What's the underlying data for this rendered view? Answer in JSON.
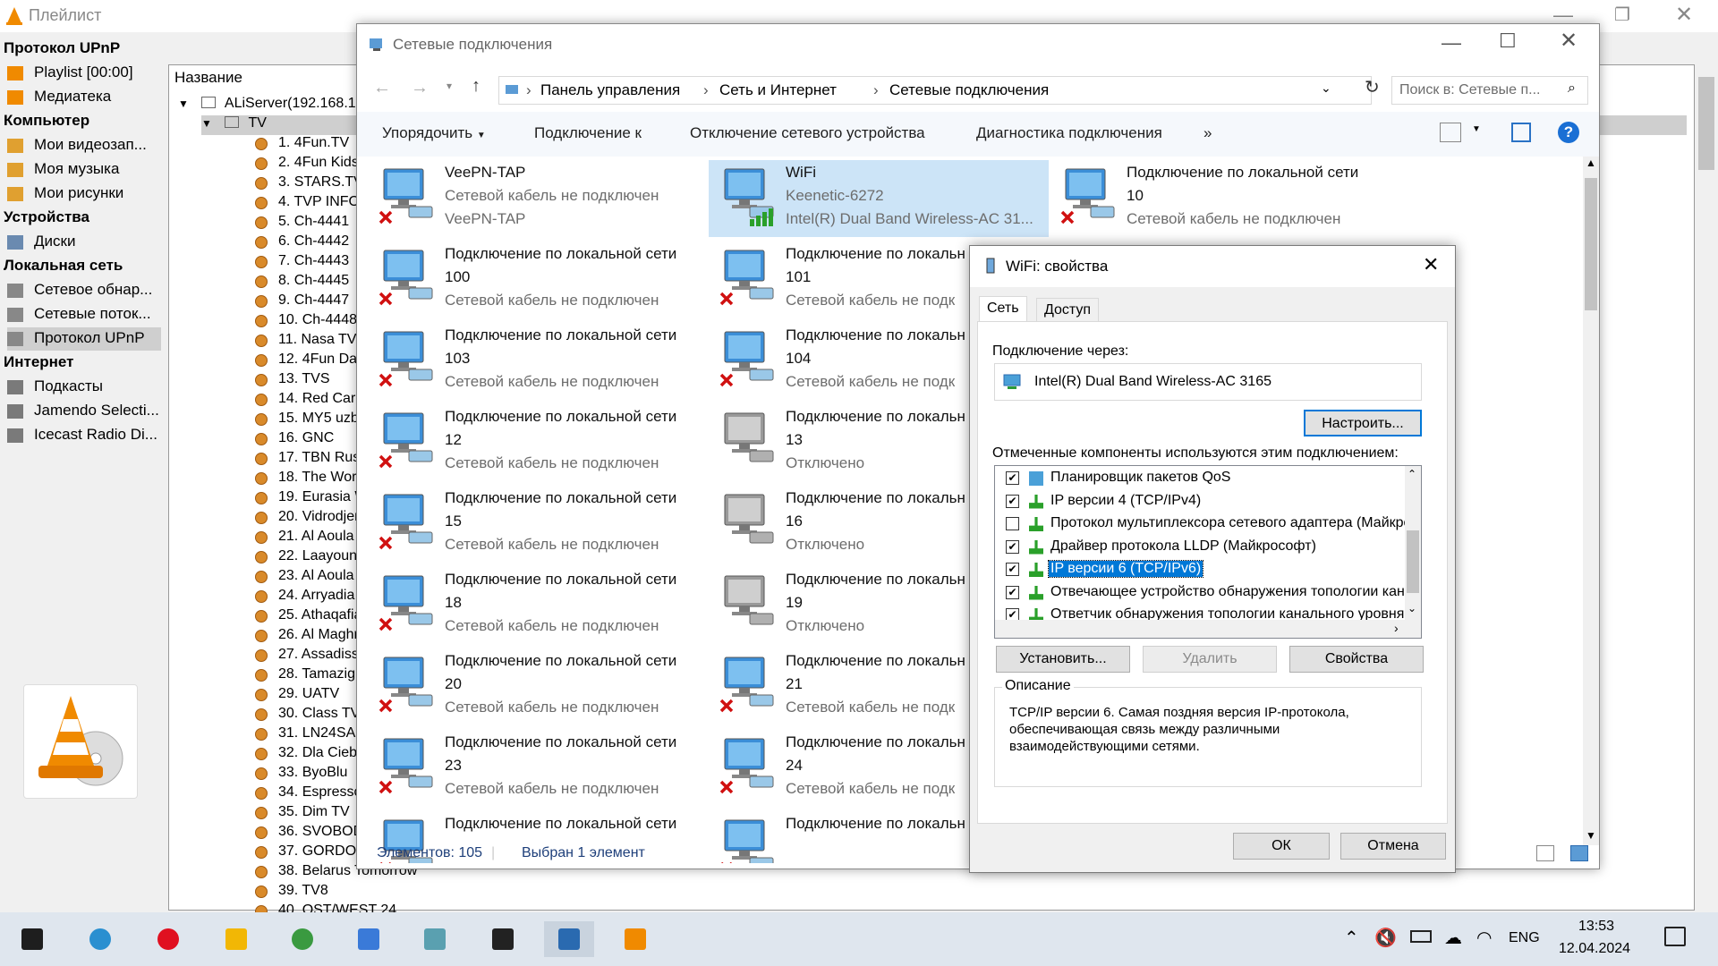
{
  "vlc": {
    "title": "Плейлист",
    "sidebar": {
      "sections": [
        {
          "header": "Протокол UPnP",
          "items": [
            "Playlist [00:00]",
            "Медиатека"
          ]
        },
        {
          "header": "Компьютер",
          "items": [
            "Мои видеозап...",
            "Моя музыка",
            "Мои рисунки"
          ]
        },
        {
          "header": "Устройства",
          "items": [
            "Диски"
          ]
        },
        {
          "header": "Локальная сеть",
          "items": [
            "Сетевое обнар...",
            "Сетевые поток...",
            "Протокол UPnP"
          ]
        },
        {
          "header": "Интернет",
          "items": [
            "Подкасты",
            "Jamendo Selecti...",
            "Icecast Radio Di..."
          ]
        }
      ]
    },
    "tree": {
      "header": "Название",
      "server": "ALiServer(192.168.1.",
      "folder": "TV",
      "channels": [
        "1. 4Fun.TV",
        "2. 4Fun Kids",
        "3. STARS.TV",
        "4. TVP INFO",
        "5. Ch-4441",
        "6. Ch-4442",
        "7. Ch-4443",
        "8. Ch-4445",
        "9. Ch-4447",
        "10. Ch-4448",
        "11. Nasa TV",
        "12. 4Fun Dar",
        "13. TVS",
        "14. Red Carp",
        "15. MY5 uzb",
        "16. GNC",
        "17. TBN Rus",
        "18. The Wor",
        "19. Eurasia W",
        "20. Vidrodjer",
        "21. Al Aoula",
        "22. Laayoune",
        "23. Al Aoula",
        "24. Arryadia",
        "25. Athaqafia",
        "26. Al Maghr",
        "27. Assadiss",
        "28. Tamazigh",
        "29. UATV",
        "30. Class TV",
        "31. LN24SA",
        "32. Dla Ciebi",
        "33. ByoBlu",
        "34. Espresso",
        "35. Dim TV",
        "36. SVOBOD",
        "37. GORDON",
        "38. Belarus Tomorrow",
        "39. TV8",
        "40. OST/WEST 24"
      ]
    }
  },
  "explorer": {
    "title": "Сетевые подключения",
    "breadcrumb": [
      "Панель управления",
      "Сеть и Интернет",
      "Сетевые подключения"
    ],
    "search_placeholder": "Поиск в: Сетевые п...",
    "commands": [
      "Упорядочить",
      "Подключение к",
      "Отключение сетевого устройства",
      "Диагностика подключения",
      "»"
    ],
    "connections": [
      {
        "name": "VeePN-TAP",
        "status": "Сетевой кабель не подключен",
        "device": "VeePN-TAP",
        "state": "disconnected"
      },
      {
        "name": "WiFi",
        "status": "Keenetic-6272",
        "device": "Intel(R) Dual Band Wireless-AC 31...",
        "state": "wifi"
      },
      {
        "name": "Подключение по локальной сети",
        "name2": "10",
        "status": "Сетевой кабель не подключен",
        "state": "disconnected"
      },
      {
        "name": "Подключение по локальной сети",
        "name2": "100",
        "status": "Сетевой кабель не подключен",
        "state": "disconnected"
      },
      {
        "name": "Подключение по локальн",
        "name2": "101",
        "status": "Сетевой кабель не подк",
        "state": "disconnected"
      },
      {
        "name": "Подключение по локальной сети",
        "name2": "103",
        "status": "Сетевой кабель не подключен",
        "state": "disconnected"
      },
      {
        "name": "Подключение по локальн",
        "name2": "104",
        "status": "Сетевой кабель не подк",
        "state": "disconnected"
      },
      {
        "name": "Подключение по локальной сети",
        "name2": "12",
        "status": "Сетевой кабель не подключен",
        "state": "disconnected"
      },
      {
        "name": "Подключение по локальн",
        "name2": "13",
        "status": "Отключено",
        "state": "disabled"
      },
      {
        "name": "Подключение по локальной сети",
        "name2": "15",
        "status": "Сетевой кабель не подключен",
        "state": "disconnected"
      },
      {
        "name": "Подключение по локальн",
        "name2": "16",
        "status": "Отключено",
        "state": "disabled"
      },
      {
        "name": "Подключение по локальной сети",
        "name2": "18",
        "status": "Сетевой кабель не подключен",
        "state": "disconnected"
      },
      {
        "name": "Подключение по локальн",
        "name2": "19",
        "status": "Отключено",
        "state": "disabled"
      },
      {
        "name": "Подключение по локальной сети",
        "name2": "20",
        "status": "Сетевой кабель не подключен",
        "state": "disconnected"
      },
      {
        "name": "Подключение по локальн",
        "name2": "21",
        "status": "Сетевой кабель не подк",
        "state": "disconnected"
      },
      {
        "name": "Подключение по локальной сети",
        "name2": "23",
        "status": "Сетевой кабель не подключен",
        "state": "disconnected"
      },
      {
        "name": "Подключение по локальн",
        "name2": "24",
        "status": "Сетевой кабель не подк",
        "state": "disconnected"
      },
      {
        "name": "Подключение по локальной сети",
        "name2": "",
        "status": "",
        "state": "disconnected"
      },
      {
        "name": "Подключение по локальн",
        "name2": "",
        "status": "",
        "state": "disconnected"
      }
    ],
    "status_count": "Элементов: 105",
    "status_selected": "Выбран 1 элемент"
  },
  "dialog": {
    "title": "WiFi: свойства",
    "tabs": [
      "Сеть",
      "Доступ"
    ],
    "connect_using_label": "Подключение через:",
    "adapter": "Intel(R) Dual Band Wireless-AC 3165",
    "configure": "Настроить...",
    "components_label": "Отмеченные компоненты используются этим подключением:",
    "components": [
      {
        "label": "Планировщик пакетов QoS",
        "checked": true
      },
      {
        "label": "IP версии 4 (TCP/IPv4)",
        "checked": true
      },
      {
        "label": "Протокол мультиплексора сетевого адаптера (Майкрософт)",
        "checked": false
      },
      {
        "label": "Драйвер протокола LLDP (Майкрософт)",
        "checked": true
      },
      {
        "label": "IP версии 6 (TCP/IPv6)",
        "checked": true,
        "selected": true
      },
      {
        "label": "Отвечающее устройство обнаружения топологии канального уровня",
        "checked": true
      },
      {
        "label": "Ответчик обнаружения топологии канального уровня",
        "checked": true
      }
    ],
    "install": "Установить...",
    "uninstall": "Удалить",
    "properties": "Свойства",
    "description_title": "Описание",
    "description": "TCP/IP версии 6. Самая поздняя версия IP-протокола, обеспечивающая связь между различными взаимодействующими сетями.",
    "ok": "ОК",
    "cancel": "Отмена"
  },
  "taskbar": {
    "lang": "ENG",
    "time": "13:53",
    "date": "12.04.2024",
    "apps": [
      "start-icon",
      "edge-icon",
      "opera-icon",
      "file-explorer-icon",
      "chrome-icon",
      "copilot-icon",
      "notepad-icon",
      "settings-icon",
      "network-connections-icon",
      "vlc-icon"
    ]
  }
}
